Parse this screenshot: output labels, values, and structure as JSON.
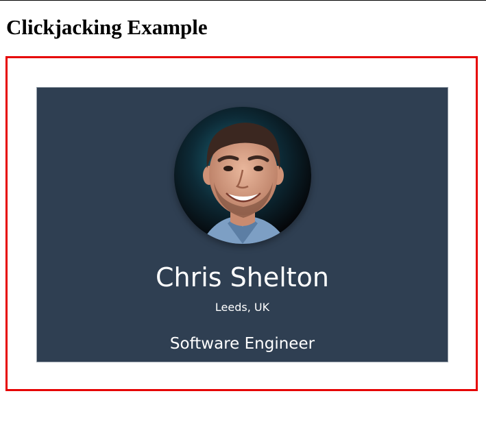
{
  "page": {
    "title": "Clickjacking Example"
  },
  "profile": {
    "name": "Chris Shelton",
    "location": "Leeds, UK",
    "job_title": "Software Engineer",
    "avatar_icon": "profile-photo"
  },
  "colors": {
    "frame_border": "#e60000",
    "card_background": "#2f3f52",
    "text": "#ffffff"
  }
}
